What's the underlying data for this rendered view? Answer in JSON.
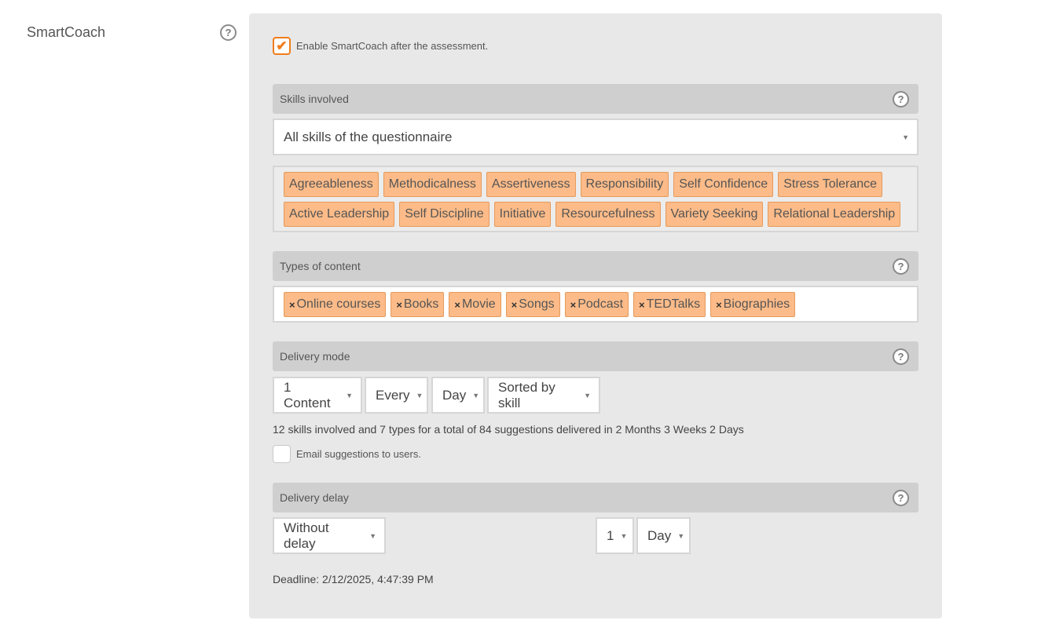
{
  "field": {
    "label": "SmartCoach",
    "help_icon": "?"
  },
  "enable": {
    "label": "Enable SmartCoach after the assessment.",
    "checked": true
  },
  "skills": {
    "title": "Skills involved",
    "select_value": "All skills of the questionnaire",
    "tags": [
      "Agreeableness",
      "Methodicalness",
      "Assertiveness",
      "Responsibility",
      "Self Confidence",
      "Stress Tolerance",
      "Active Leadership",
      "Self Discipline",
      "Initiative",
      "Resourcefulness",
      "Variety Seeking",
      "Relational Leadership"
    ]
  },
  "content_types": {
    "title": "Types of content",
    "tags": [
      "Online courses",
      "Books",
      "Movie",
      "Songs",
      "Podcast",
      "TEDTalks",
      "Biographies"
    ]
  },
  "delivery_mode": {
    "title": "Delivery mode",
    "quantity": "1 Content",
    "frequency": "Every",
    "unit": "Day",
    "sort": "Sorted by skill",
    "summary": "12 skills involved and 7 types for a total of 84 suggestions delivered in 2 Months 3 Weeks 2 Days",
    "email_label": "Email suggestions to users.",
    "email_checked": false
  },
  "delivery_delay": {
    "title": "Delivery delay",
    "mode": "Without delay",
    "amount": "1",
    "unit": "Day",
    "deadline": "Deadline: 2/12/2025, 4:47:39 PM"
  },
  "icons": {
    "help": "question-circle-icon",
    "caret": "caret-down-icon",
    "remove": "times-icon",
    "check": "checkmark-icon"
  },
  "colors": {
    "accent": "#f07c1c",
    "tag_bg": "#fcbb88",
    "panel_bg": "#e8e8e8",
    "header_bg": "#cfcfcf"
  }
}
